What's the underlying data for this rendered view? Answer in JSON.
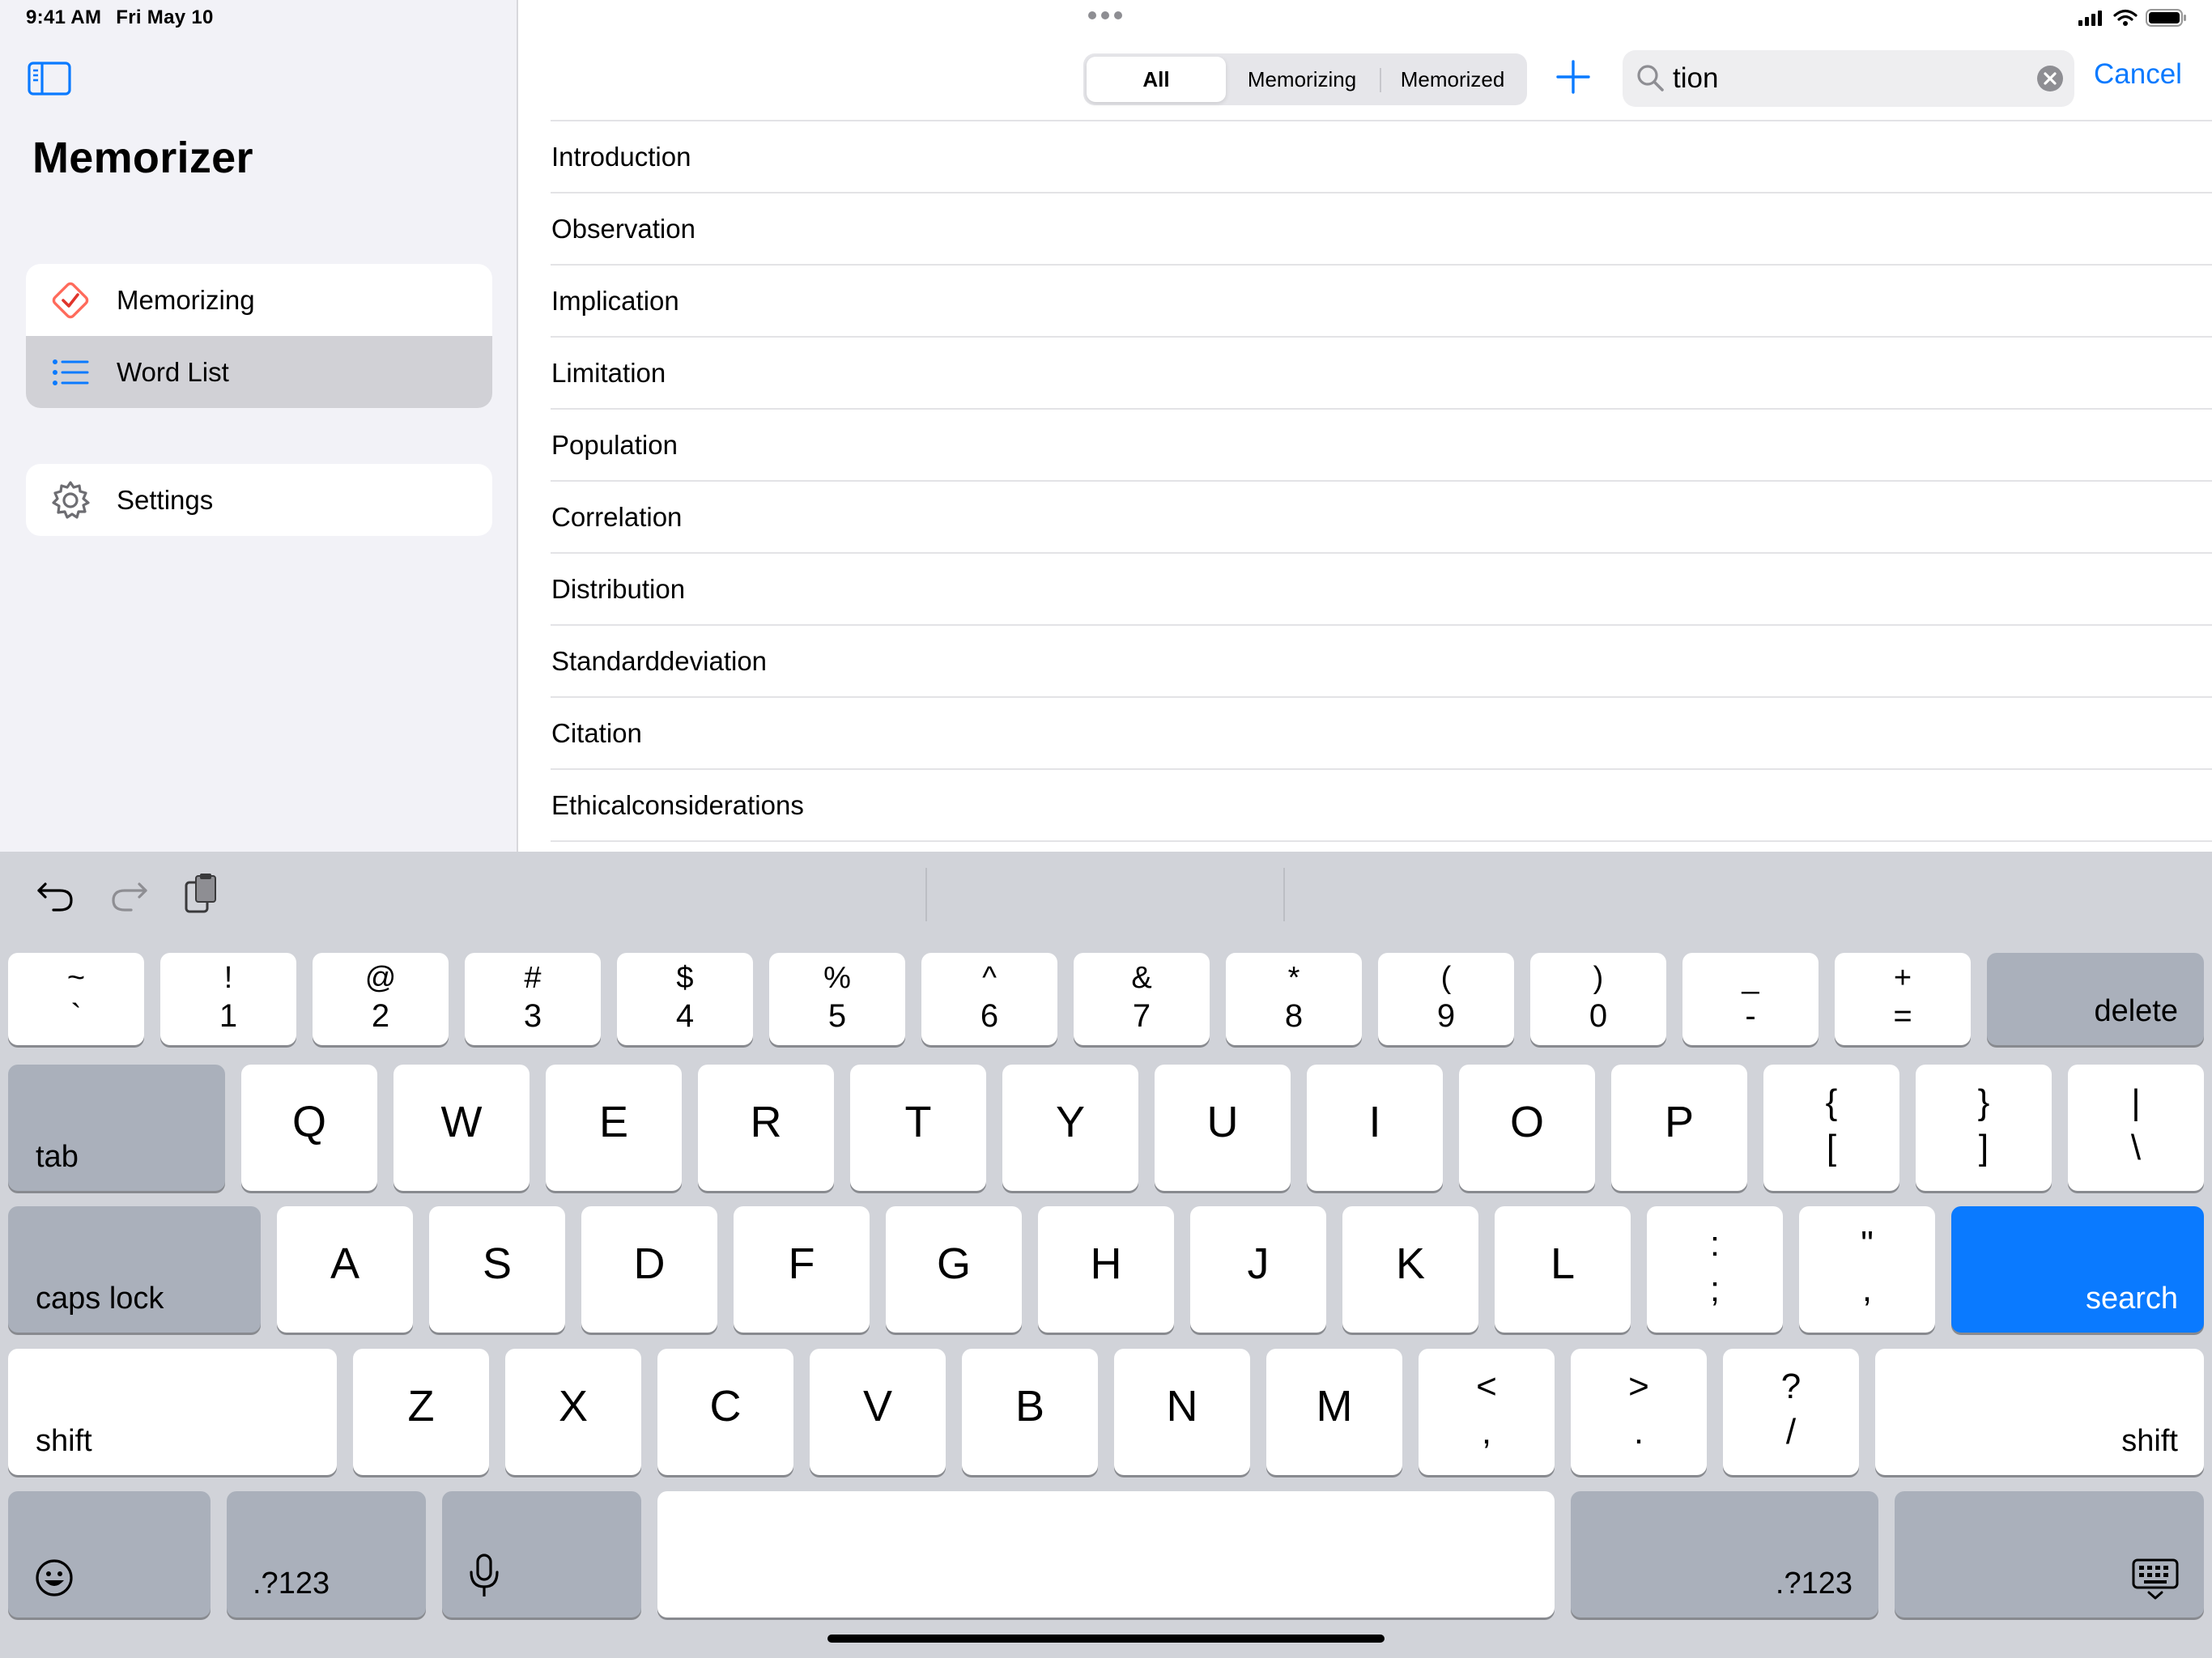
{
  "status_bar": {
    "time": "9:41 AM",
    "date": "Fri May 10"
  },
  "sidebar": {
    "title": "Memorizer",
    "items": [
      {
        "label": "Memorizing",
        "icon": "diamond-check-icon",
        "selected": false
      },
      {
        "label": "Word List",
        "icon": "list-icon",
        "selected": true
      }
    ],
    "settings": {
      "label": "Settings",
      "icon": "gear-icon"
    }
  },
  "toolbar": {
    "segments": [
      "All",
      "Memorizing",
      "Memorized"
    ],
    "selected_segment": "All",
    "search_value": "tion",
    "search_placeholder": "Search",
    "cancel_label": "Cancel"
  },
  "words": [
    "Introduction",
    "Observation",
    "Implication",
    "Limitation",
    "Population",
    "Correlation",
    "Distribution",
    "Standarddeviation",
    "Citation",
    "Ethicalconsiderations"
  ],
  "keyboard": {
    "number_row": [
      {
        "top": "~",
        "bottom": "`"
      },
      {
        "top": "!",
        "bottom": "1"
      },
      {
        "top": "@",
        "bottom": "2"
      },
      {
        "top": "#",
        "bottom": "3"
      },
      {
        "top": "$",
        "bottom": "4"
      },
      {
        "top": "%",
        "bottom": "5"
      },
      {
        "top": "^",
        "bottom": "6"
      },
      {
        "top": "&",
        "bottom": "7"
      },
      {
        "top": "*",
        "bottom": "8"
      },
      {
        "top": "(",
        "bottom": "9"
      },
      {
        "top": ")",
        "bottom": "0"
      },
      {
        "top": "_",
        "bottom": "-"
      },
      {
        "top": "+",
        "bottom": "="
      }
    ],
    "delete": "delete",
    "tab": "tab",
    "qwerty_row": [
      "Q",
      "W",
      "E",
      "R",
      "T",
      "Y",
      "U",
      "I",
      "O",
      "P"
    ],
    "bracket_keys": [
      {
        "top": "{",
        "bottom": "["
      },
      {
        "top": "}",
        "bottom": "]"
      },
      {
        "top": "|",
        "bottom": "\\"
      }
    ],
    "caps_lock": "caps lock",
    "home_row": [
      "A",
      "S",
      "D",
      "F",
      "G",
      "H",
      "J",
      "K",
      "L"
    ],
    "home_row_punct": [
      {
        "top": ":",
        "bottom": ";"
      },
      {
        "top": "\"",
        "bottom": ","
      }
    ],
    "search": "search",
    "shift": "shift",
    "bottom_letters": [
      "Z",
      "X",
      "C",
      "V",
      "B",
      "N",
      "M"
    ],
    "bottom_punct": [
      {
        "top": "<",
        "bottom": ","
      },
      {
        "top": ">",
        "bottom": "."
      },
      {
        "top": "?",
        "bottom": "/"
      }
    ],
    "numbers_toggle": ".?123",
    "accent_color": "#0a7aff"
  }
}
